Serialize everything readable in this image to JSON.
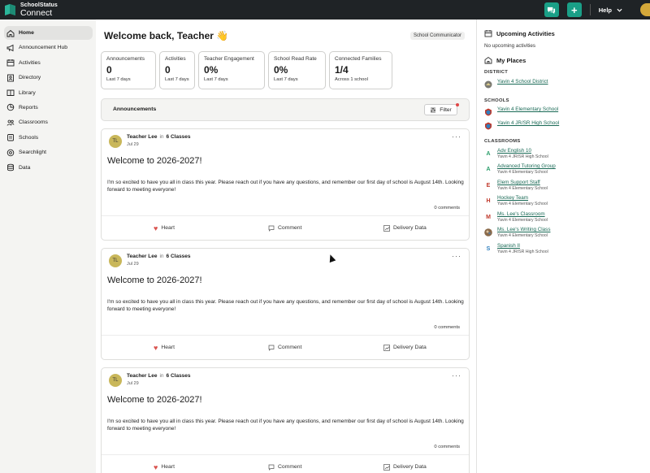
{
  "brand": {
    "top": "SchoolStatus",
    "bottom": "Connect"
  },
  "topbar": {
    "help_label": "Help"
  },
  "sidebar": {
    "items": [
      {
        "label": "Home",
        "icon": "home-icon"
      },
      {
        "label": "Announcement Hub",
        "icon": "megaphone-icon"
      },
      {
        "label": "Activities",
        "icon": "calendar-icon"
      },
      {
        "label": "Directory",
        "icon": "directory-icon"
      },
      {
        "label": "Library",
        "icon": "book-icon"
      },
      {
        "label": "Reports",
        "icon": "reports-icon"
      },
      {
        "label": "Classrooms",
        "icon": "classrooms-icon"
      },
      {
        "label": "Schools",
        "icon": "schools-icon"
      },
      {
        "label": "Searchlight",
        "icon": "searchlight-icon"
      },
      {
        "label": "Data",
        "icon": "data-icon"
      }
    ]
  },
  "main": {
    "welcome": "Welcome back, Teacher 👋",
    "role": "School Communicator",
    "stats": [
      {
        "label": "Announcements",
        "value": "0",
        "sub": "Last 7 days"
      },
      {
        "label": "Activities",
        "value": "0",
        "sub": "Last 7 days"
      },
      {
        "label": "Teacher Engagement",
        "value": "0%",
        "sub": "Last 7 days"
      },
      {
        "label": "School Read Rate",
        "value": "0%",
        "sub": "Last 7 days"
      },
      {
        "label": "Connected Families",
        "value": "1/4",
        "sub": "Across 1 school"
      }
    ],
    "announcements_title": "Announcements",
    "filter_label": "Filter",
    "posts": [
      {
        "initials": "TL",
        "author": "Teacher Lee",
        "in": "in",
        "group": "6 Classes",
        "date": "Jul 29",
        "title": "Welcome to 2026-2027!",
        "body": "I'm so excited to have you all in class this year. Please reach out if you have any questions, and remember our first day of school is August 14th. Looking forward to meeting everyone!",
        "comments": "0 comments",
        "heart": "Heart",
        "comment": "Comment",
        "delivery": "Delivery Data"
      },
      {
        "initials": "TL",
        "author": "Teacher Lee",
        "in": "in",
        "group": "6 Classes",
        "date": "Jul 29",
        "title": "Welcome to 2026-2027!",
        "body": "I'm so excited to have you all in class this year. Please reach out if you have any questions, and remember our first day of school is August 14th. Looking forward to meeting everyone!",
        "comments": "0 comments",
        "heart": "Heart",
        "comment": "Comment",
        "delivery": "Delivery Data"
      },
      {
        "initials": "TL",
        "author": "Teacher Lee",
        "in": "in",
        "group": "6 Classes",
        "date": "Jul 29",
        "title": "Welcome to 2026-2027!",
        "body": "I'm so excited to have you all in class this year. Please reach out if you have any questions, and remember our first day of school is August 14th. Looking forward to meeting everyone!",
        "comments": "0 comments",
        "heart": "Heart",
        "comment": "Comment",
        "delivery": "Delivery Data"
      }
    ]
  },
  "right": {
    "upcoming_title": "Upcoming Activities",
    "upcoming_empty": "No upcoming activities",
    "places_title": "My Places",
    "district_label": "DISTRICT",
    "district": {
      "name": "Yavin 4 School District"
    },
    "schools_label": "SCHOOLS",
    "schools": [
      {
        "name": "Yavin 4 Elementary School"
      },
      {
        "name": "Yavin 4 JR/SR High School"
      }
    ],
    "classrooms_label": "CLASSROOMS",
    "classrooms": [
      {
        "letter": "A",
        "name": "Adv English 10",
        "school": "Yavin 4 JR/SR High School",
        "color": "#2a9d6a"
      },
      {
        "letter": "A",
        "name": "Advanced Tutoring Group",
        "school": "Yavin 4 Elementary School",
        "color": "#2a9d6a"
      },
      {
        "letter": "E",
        "name": "Elem Support Staff",
        "school": "Yavin 4 Elementary School",
        "color": "#c0392b"
      },
      {
        "letter": "H",
        "name": "Hockey Team",
        "school": "Yavin 4 Elementary School",
        "color": "#c0392b"
      },
      {
        "letter": "M",
        "name": "Ms. Lee's Classroom",
        "school": "Yavin 4 Elementary School",
        "color": "#c0392b"
      },
      {
        "letter": "",
        "name": "Ms. Lee's Writing Class",
        "school": "Yavin 4 Elementary School",
        "color": "#8a6a4a"
      },
      {
        "letter": "S",
        "name": "Spanish II",
        "school": "Yavin 4 JR/SR High School",
        "color": "#2f7fbf"
      }
    ]
  }
}
